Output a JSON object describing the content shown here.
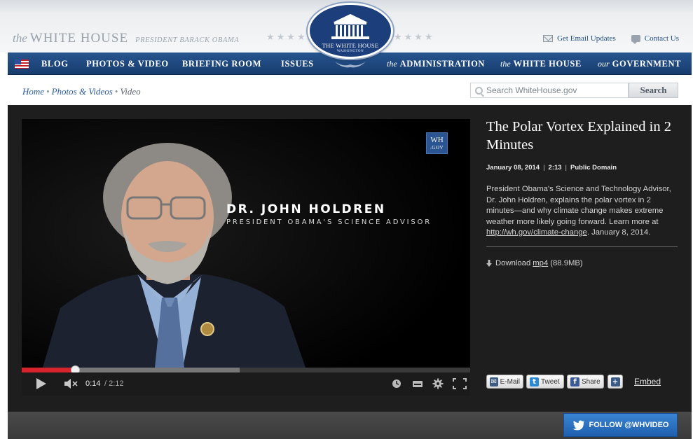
{
  "header": {
    "brand_prefix": "the",
    "brand_name": "WHITE HOUSE",
    "brand_sub": "PRESIDENT BARACK OBAMA",
    "seal_title": "THE WHITE HOUSE",
    "seal_sub": "WASHINGTON",
    "links": [
      {
        "label": "Get Email Updates",
        "icon": "envelope-icon"
      },
      {
        "label": "Contact Us",
        "icon": "speech-bubble-icon"
      }
    ]
  },
  "nav": {
    "items": [
      {
        "prefix": "",
        "label": "BLOG"
      },
      {
        "prefix": "",
        "label": "PHOTOS & VIDEO"
      },
      {
        "prefix": "",
        "label": "BRIEFING ROOM"
      },
      {
        "prefix": "",
        "label": "ISSUES"
      },
      {
        "prefix": "the",
        "label": "ADMINISTRATION"
      },
      {
        "prefix": "the",
        "label": "WHITE HOUSE"
      },
      {
        "prefix": "our",
        "label": "GOVERNMENT"
      }
    ]
  },
  "breadcrumb": {
    "items": [
      "Home",
      "Photos & Videos"
    ],
    "separator": "•",
    "current": "Video"
  },
  "search": {
    "placeholder": "Search WhiteHouse.gov",
    "button_label": "Search"
  },
  "player": {
    "logo_line1": "WH",
    "logo_line2": ".GOV",
    "lower_third_name": "DR. JOHN HOLDREN",
    "lower_third_title": "PRESIDENT OBAMA'S SCIENCE ADVISOR",
    "current_time": "0:14",
    "total_time": "/ 2:12",
    "played_fraction": 0.119,
    "buffered_fraction": 0.486,
    "accent_color": "#d7232b"
  },
  "video": {
    "title": "The Polar Vortex Explained in 2 Minutes",
    "date": "January 08, 2014",
    "duration": "2:13",
    "license": "Public Domain",
    "description_before_link": "President Obama's Science and Technology Advisor, Dr. John Holdren, explains the polar vortex in 2 minutes—and why climate change makes extreme weather more likely going forward. Learn more at ",
    "description_link": "http://wh.gov/climate-change",
    "description_after_link": ". January 8, 2014.",
    "download_label": "Download",
    "download_format": "mp4",
    "download_size": "(88.9MB)"
  },
  "share": {
    "email_label": "E-Mail",
    "tweet_label": "Tweet",
    "share_label": "Share",
    "more_label": "+",
    "embed_label": "Embed"
  },
  "follow": {
    "label": "FOLLOW @WHVIDEO"
  }
}
